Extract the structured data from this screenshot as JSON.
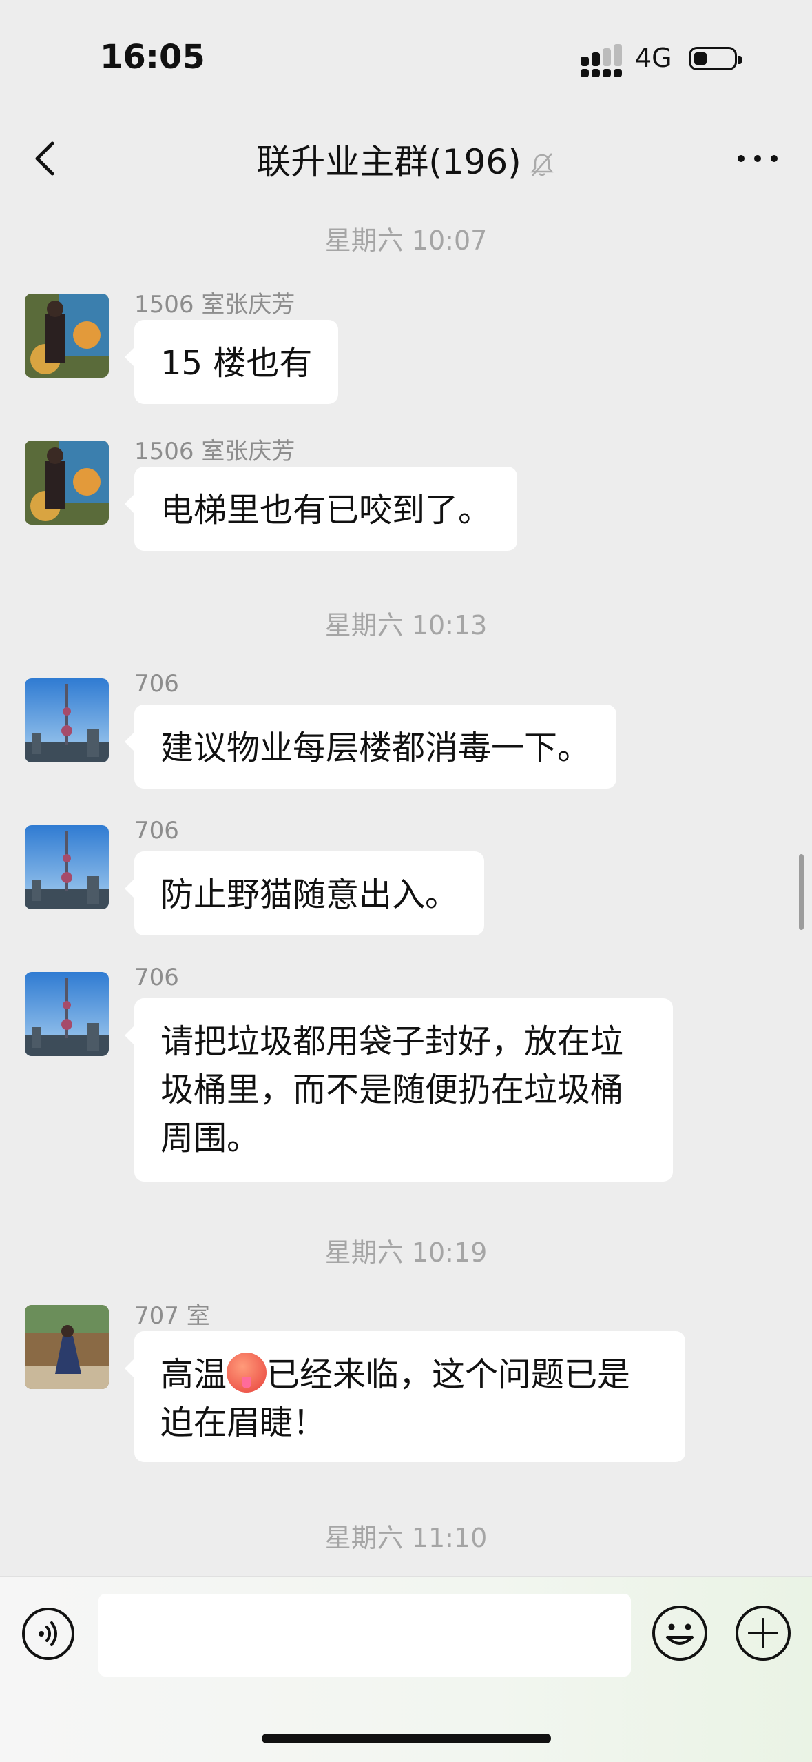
{
  "status_bar": {
    "time": "16:05",
    "network": "4G"
  },
  "header": {
    "title": "联升业主群(196)"
  },
  "messages": [
    {
      "type": "timestamp",
      "text": "星期六 10:07"
    },
    {
      "type": "message",
      "sender": "1506 室张庆芳",
      "text": "15 楼也有"
    },
    {
      "type": "message",
      "sender": "1506 室张庆芳",
      "text": "电梯里也有已咬到了。"
    },
    {
      "type": "timestamp",
      "text": "星期六 10:13"
    },
    {
      "type": "message",
      "sender": "706",
      "text": "建议物业每层楼都消毒一下。"
    },
    {
      "type": "message",
      "sender": "706",
      "text": "防止野猫随意出入。"
    },
    {
      "type": "message",
      "sender": "706",
      "lines": [
        "请把垃圾都用袋子封好，放在垃",
        "圾桶里，而不是随便扔在垃圾桶",
        "周围。"
      ]
    },
    {
      "type": "timestamp",
      "text": "星期六 10:19"
    },
    {
      "type": "message",
      "sender": "707 室",
      "text_before_emoji": "高温",
      "emoji": "hot-face-emoji",
      "text_after_emoji": "已经来临，这个问题已是",
      "line2": "迫在眉睫！"
    },
    {
      "type": "timestamp",
      "text": "星期六 11:10"
    }
  ],
  "input_bar": {
    "text_value": "",
    "icons": [
      "voice-icon",
      "emoji-icon",
      "plus-icon"
    ]
  },
  "colors": {
    "background": "#ededed",
    "bubble": "#ffffff",
    "timestamp": "#a5a5a5"
  }
}
